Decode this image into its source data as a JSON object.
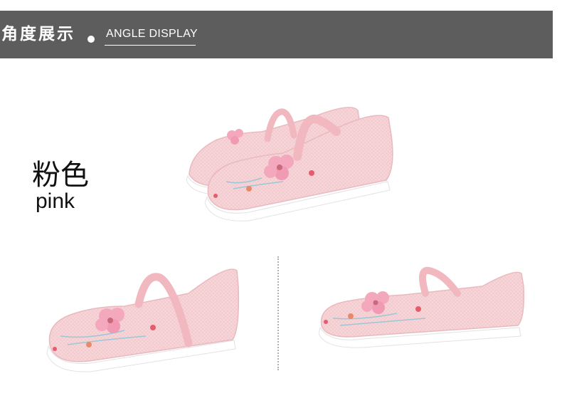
{
  "header": {
    "title_cn": "角度展示",
    "title_en": "ANGLE DISPLAY"
  },
  "color_label": {
    "cn": "粉色",
    "en": "pink"
  },
  "colors": {
    "banner": "#5d5d5d",
    "shoe_pink": "#f6d3d6",
    "sole": "#ffffff"
  }
}
